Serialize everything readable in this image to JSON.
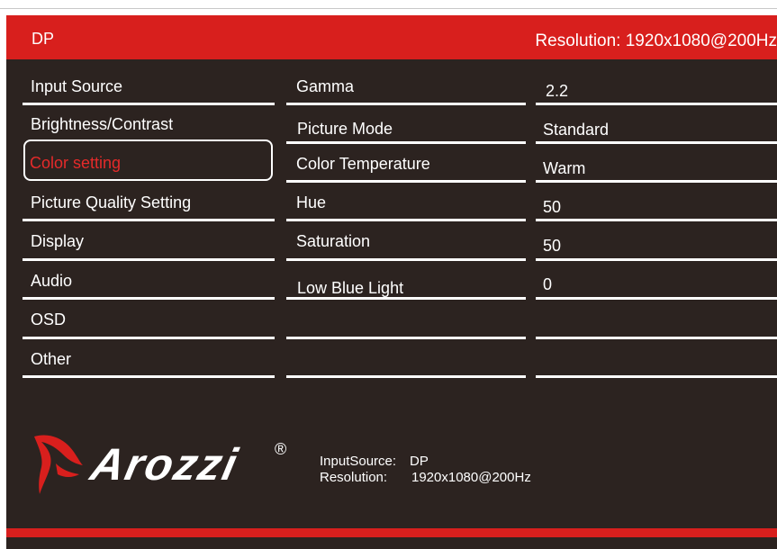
{
  "header": {
    "source": "DP",
    "resolution": "Resolution: 1920x1080@200Hz"
  },
  "menu": {
    "items": [
      {
        "label": "Input Source",
        "selected": false
      },
      {
        "label": "Brightness/Contrast",
        "selected": false
      },
      {
        "label": "Color setting",
        "selected": true
      },
      {
        "label": "Picture Quality Setting",
        "selected": false
      },
      {
        "label": "Display",
        "selected": false
      },
      {
        "label": "Audio",
        "selected": false
      },
      {
        "label": "OSD",
        "selected": false
      },
      {
        "label": "Other",
        "selected": false
      }
    ]
  },
  "settings": [
    {
      "label": "Gamma",
      "value": "2.2"
    },
    {
      "label": "Picture Mode",
      "value": "Standard"
    },
    {
      "label": "Color Temperature",
      "value": "Warm"
    },
    {
      "label": "Hue",
      "value": "50"
    },
    {
      "label": "Saturation",
      "value": "50"
    },
    {
      "label": "Low Blue Light",
      "value": "0"
    }
  ],
  "logo": {
    "brand": "Arozzi",
    "registered": "®"
  },
  "info": {
    "input_label": "InputSource:",
    "input_value": "DP",
    "resolution_label": "Resolution:",
    "resolution_value": "1920x1080@200Hz"
  },
  "colors": {
    "accent": "#d81f1d",
    "background": "#2c2320",
    "selected_text": "#e52a2a"
  }
}
